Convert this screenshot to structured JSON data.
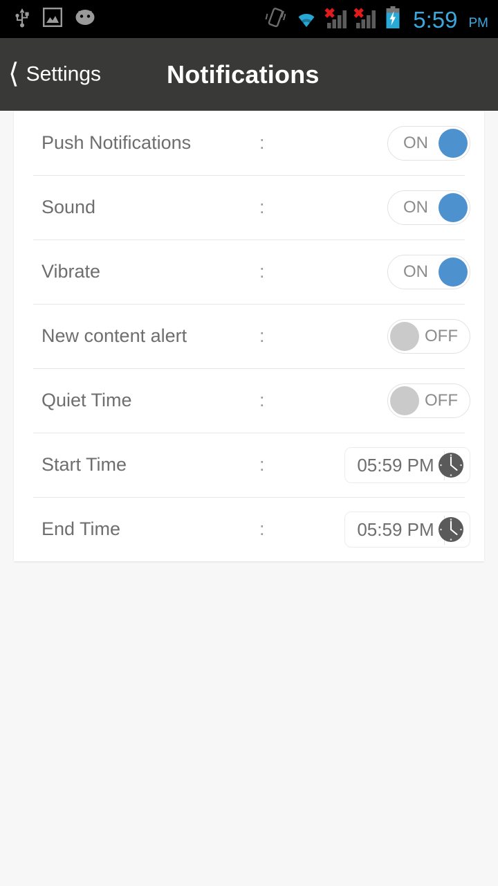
{
  "statusbar": {
    "left_icons": [
      "usb-icon",
      "screenshot-image-icon",
      "android-head-icon"
    ],
    "right_icons": [
      "vibrate-icon",
      "wifi-icon",
      "signal-no-sim-1-icon",
      "signal-no-sim-2-icon",
      "battery-charging-icon"
    ],
    "time": "5:59",
    "ampm": "PM",
    "clock_color": "#3aa8dd",
    "background": "#000000"
  },
  "header": {
    "back_label": "Settings",
    "title": "Notifications",
    "background": "#393a37",
    "text_color": "#ffffff"
  },
  "settings": {
    "rows": [
      {
        "label": "Push Notifications",
        "separator": ":",
        "control": "toggle",
        "state": "ON"
      },
      {
        "label": "Sound",
        "separator": ":",
        "control": "toggle",
        "state": "ON"
      },
      {
        "label": "Vibrate",
        "separator": ":",
        "control": "toggle",
        "state": "ON"
      },
      {
        "label": "New content alert",
        "separator": ":",
        "control": "toggle",
        "state": "OFF"
      },
      {
        "label": "Quiet Time",
        "separator": ":",
        "control": "toggle",
        "state": "OFF"
      },
      {
        "label": "Start Time",
        "separator": ":",
        "control": "time",
        "value": "05:59 PM",
        "icon": "clock-icon"
      },
      {
        "label": "End Time",
        "separator": ":",
        "control": "time",
        "value": "05:59 PM",
        "icon": "clock-icon"
      }
    ]
  },
  "colors": {
    "page_background": "#f7f7f8",
    "card_background": "#ffffff",
    "toggle_on_thumb": "#4e91cf",
    "toggle_off_thumb": "#cacaca",
    "label_text": "#6e6e6e",
    "divider": "#e6e6e6"
  }
}
